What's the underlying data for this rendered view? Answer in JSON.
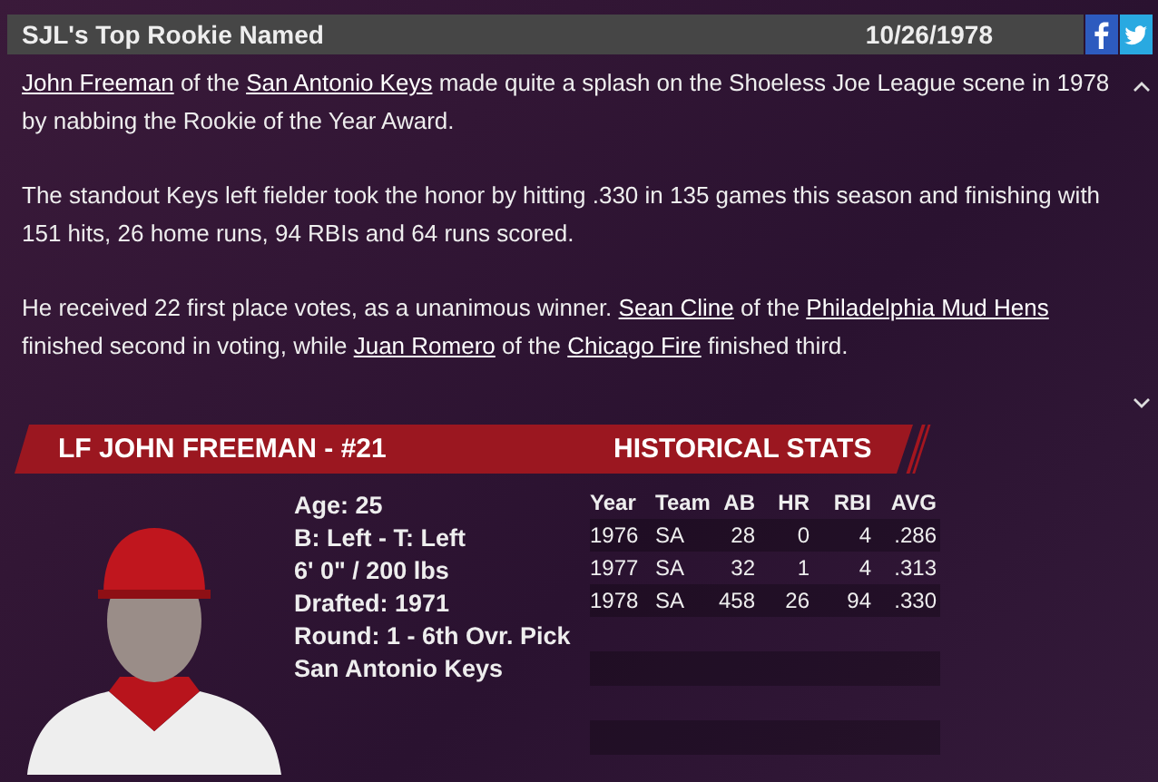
{
  "header": {
    "title": "SJL's Top Rookie Named",
    "date": "10/26/1978"
  },
  "article": {
    "paragraphs": [
      [
        {
          "text": "John Freeman",
          "link": true
        },
        {
          "text": " of the ",
          "link": false
        },
        {
          "text": "San Antonio Keys",
          "link": true
        },
        {
          "text": " made quite a splash on the Shoeless Joe League scene in 1978 by nabbing the Rookie of the Year Award.",
          "link": false
        }
      ],
      [
        {
          "text": "The standout Keys left fielder took the honor by hitting .330 in 135 games this season and finishing with 151 hits, 26 home runs, 94 RBIs and 64 runs scored.",
          "link": false
        }
      ],
      [
        {
          "text": "He received 22 first place votes, as a unanimous winner. ",
          "link": false
        },
        {
          "text": "Sean Cline",
          "link": true
        },
        {
          "text": " of the ",
          "link": false
        },
        {
          "text": "Philadelphia Mud Hens",
          "link": true
        },
        {
          "text": " finished second in voting, while ",
          "link": false
        },
        {
          "text": "Juan Romero",
          "link": true
        },
        {
          "text": " of the ",
          "link": false
        },
        {
          "text": "Chicago Fire",
          "link": true
        },
        {
          "text": " finished third.",
          "link": false
        }
      ]
    ]
  },
  "player": {
    "banner": "LF JOHN FREEMAN - #21",
    "info": [
      "Age: 25",
      "B: Left - T: Left",
      "6' 0\" / 200 lbs",
      "Drafted: 1971",
      "Round: 1 - 6th Ovr. Pick",
      "San Antonio Keys"
    ]
  },
  "stats": {
    "title": "HISTORICAL STATS",
    "columns": [
      "Year",
      "Team",
      "AB",
      "HR",
      "RBI",
      "AVG"
    ],
    "rows": [
      [
        "1976",
        "SA",
        "28",
        "0",
        "4",
        ".286"
      ],
      [
        "1977",
        "SA",
        "32",
        "1",
        "4",
        ".313"
      ],
      [
        "1978",
        "SA",
        "458",
        "26",
        "94",
        ".330"
      ]
    ]
  }
}
